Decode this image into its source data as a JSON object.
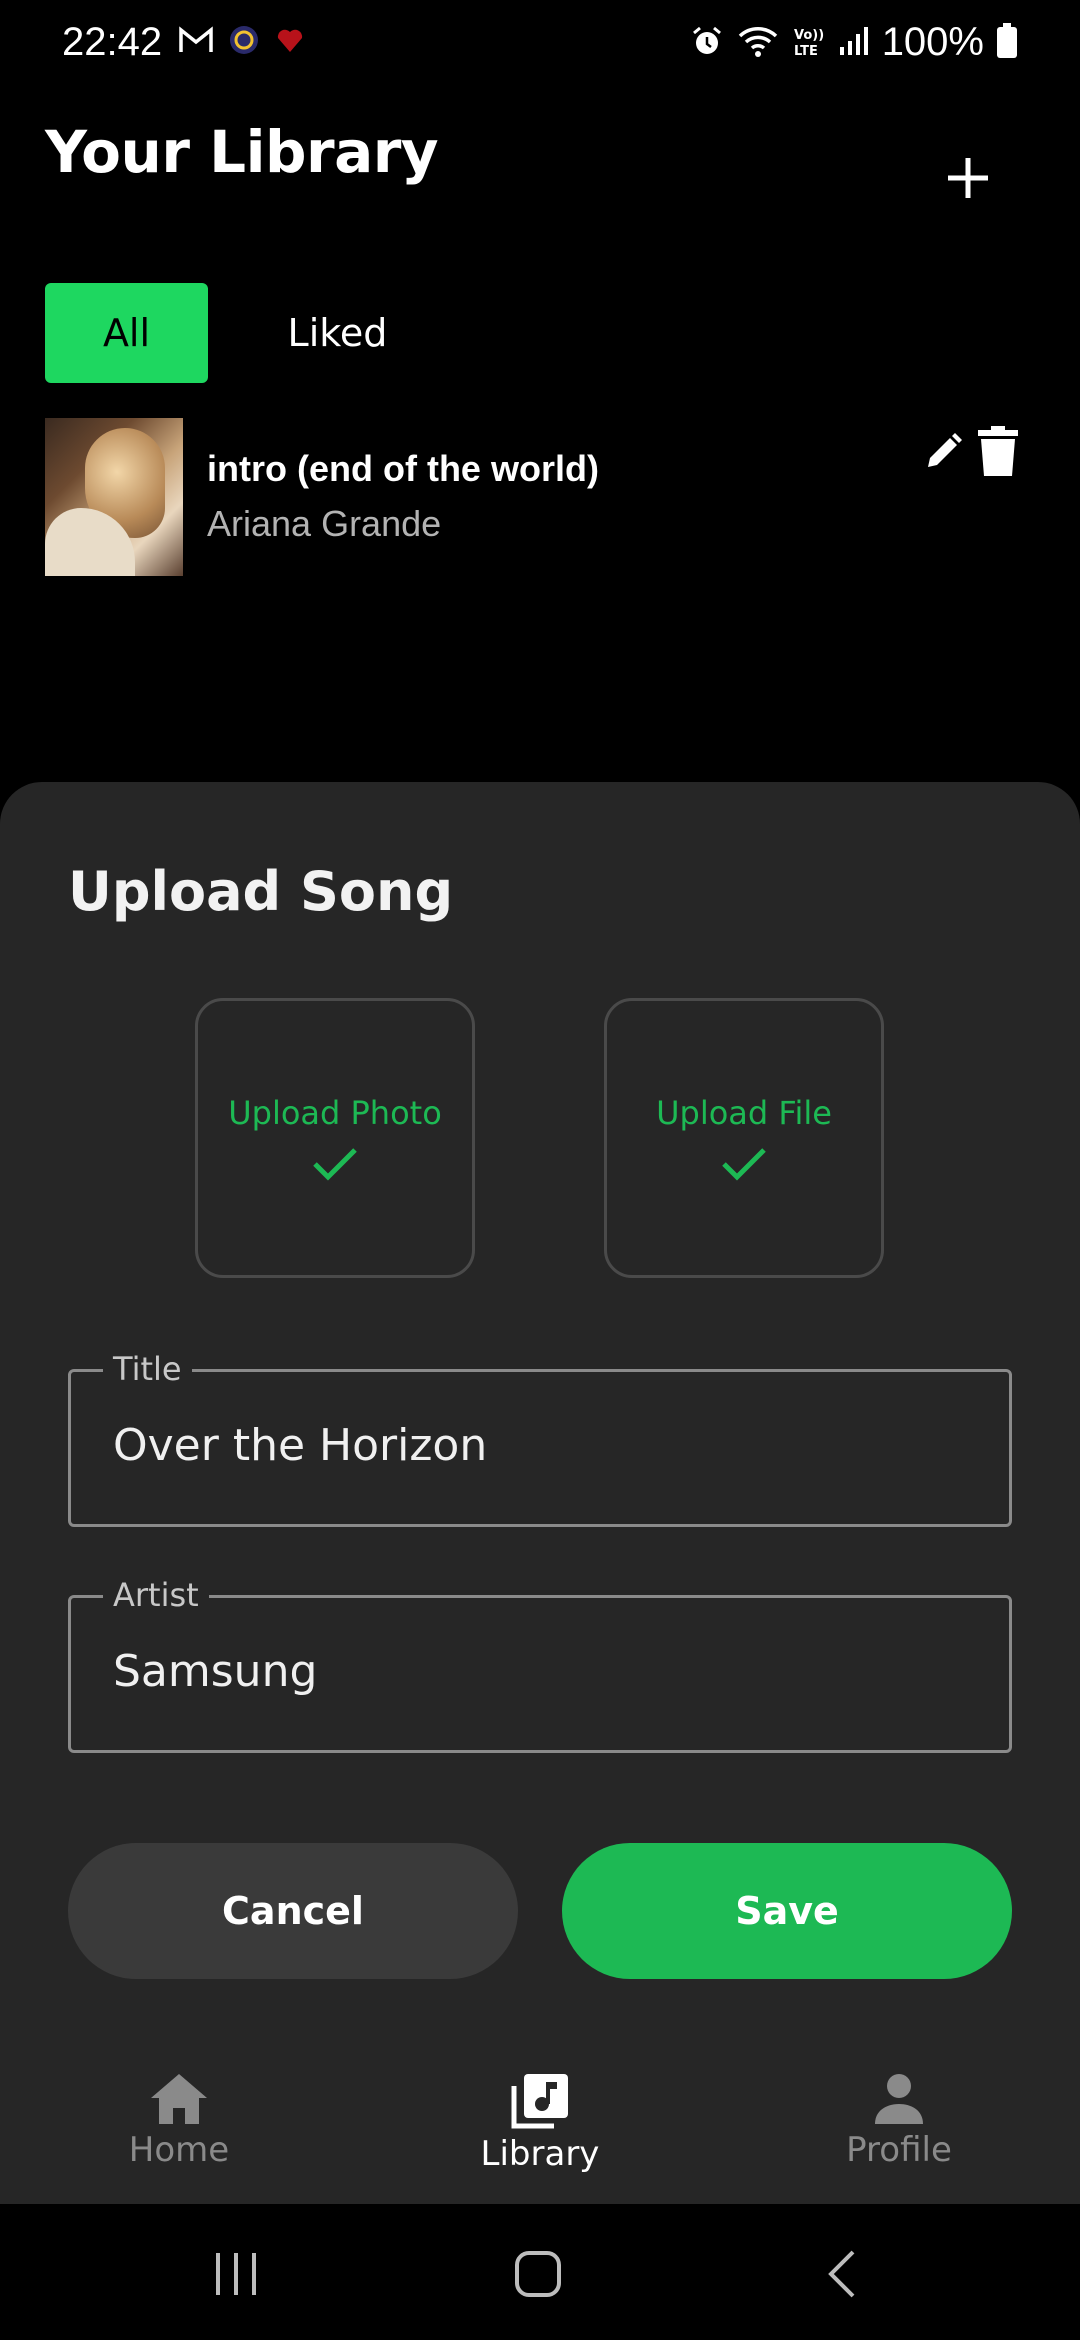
{
  "status_bar": {
    "time": "22:42",
    "battery_percent": "100%",
    "icons_left": [
      "gmail-icon",
      "circle-app-icon",
      "heart-app-icon"
    ],
    "icons_right": [
      "alarm-icon",
      "wifi-icon",
      "volte-icon",
      "signal-icon",
      "battery-icon"
    ]
  },
  "header": {
    "title": "Your Library"
  },
  "filters": {
    "all_label": "All",
    "liked_label": "Liked",
    "selected": "All"
  },
  "songs": [
    {
      "title": "intro (end of the world)",
      "artist": "Ariana Grande"
    }
  ],
  "upload_sheet": {
    "title": "Upload Song",
    "upload_photo_label": "Upload Photo",
    "upload_file_label": "Upload File",
    "title_field": {
      "label": "Title",
      "value": "Over the Horizon"
    },
    "artist_field": {
      "label": "Artist",
      "value": "Samsung"
    },
    "cancel_label": "Cancel",
    "save_label": "Save"
  },
  "bottom_nav": {
    "items": [
      {
        "label": "Home",
        "icon": "home-icon",
        "active": false
      },
      {
        "label": "Library",
        "icon": "library-icon",
        "active": true
      },
      {
        "label": "Profile",
        "icon": "profile-icon",
        "active": false
      }
    ]
  },
  "colors": {
    "accent": "#1ed760",
    "save_button": "#1db954",
    "sheet_background": "#262626",
    "background": "#000000"
  }
}
